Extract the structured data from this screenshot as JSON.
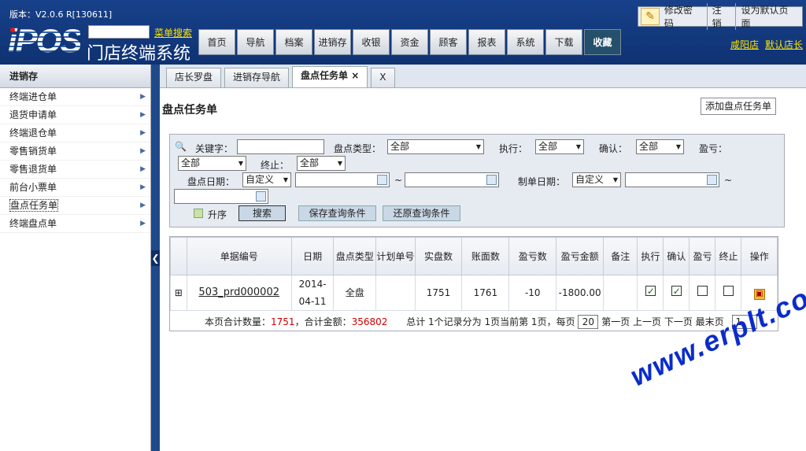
{
  "header": {
    "version": "版本：V2.0.6 R[130611]",
    "logo": "iPOS",
    "system_name": "门店终端系统",
    "menu_search": "菜单搜索",
    "nav": [
      "首页",
      "导航",
      "档案",
      "进销存",
      "收银",
      "资金",
      "顾客",
      "报表",
      "系统",
      "下载",
      "收藏"
    ],
    "top_links": [
      "修改密码",
      "注销",
      "设为默认页面"
    ],
    "store": "咸阳店",
    "default_store": "默认店长"
  },
  "sidebar": {
    "title": "进销存",
    "items": [
      "终端进仓单",
      "退货申请单",
      "终端退仓单",
      "零售销货单",
      "零售退货单",
      "前台小票单",
      "盘点任务单",
      "终端盘点单"
    ]
  },
  "tabs": [
    "店长罗盘",
    "进销存导航",
    "盘点任务单 ×",
    "X"
  ],
  "page": {
    "title": "盘点任务单",
    "add_button": "添加盘点任务单"
  },
  "filter": {
    "keyword_label": "关键字：",
    "type_label": "盘点类型：",
    "type_value": "全部",
    "exec_label": "执行：",
    "exec_value": "全部",
    "confirm_label": "确认：",
    "confirm_value": "全部",
    "pl_label": "盈亏：",
    "pl_value": "全部",
    "stop_label": "终止：",
    "stop_value": "全部",
    "date_label": "盘点日期：",
    "date_value": "自定义",
    "tilde": "~",
    "make_date_label": "制单日期：",
    "make_date_value": "自定义",
    "asc_label": "升序",
    "search": "搜索",
    "save": "保存查询条件",
    "restore": "还原查询条件"
  },
  "grid": {
    "headers": [
      "单据编号",
      "日期",
      "盘点类型",
      "计划单号",
      "实盘数",
      "账面数",
      "盈亏数",
      "盈亏金额",
      "备注",
      "执行",
      "确认",
      "盈亏",
      "终止",
      "操作"
    ],
    "rows": [
      {
        "no": "503_prd000002",
        "date": "2014-04-11",
        "type": "全盘",
        "plan": "",
        "actual": "1751",
        "book": "1761",
        "diff": "-10",
        "amount": "-1800.00",
        "note": "",
        "exec": true,
        "confirm": true,
        "pl": false,
        "stop": false
      }
    ],
    "sum_qty_label": "本页合计数量：",
    "sum_qty": "1751",
    "sum_amt_label": "，合计金额：",
    "sum_amt": "356802",
    "pager": "总计 1个记录分为 1页当前第 1页，每页",
    "page_size": "20",
    "pager_links": "第一页 上一页 下一页 最末页",
    "page_no": "1"
  },
  "watermark": "www.erplt.com"
}
